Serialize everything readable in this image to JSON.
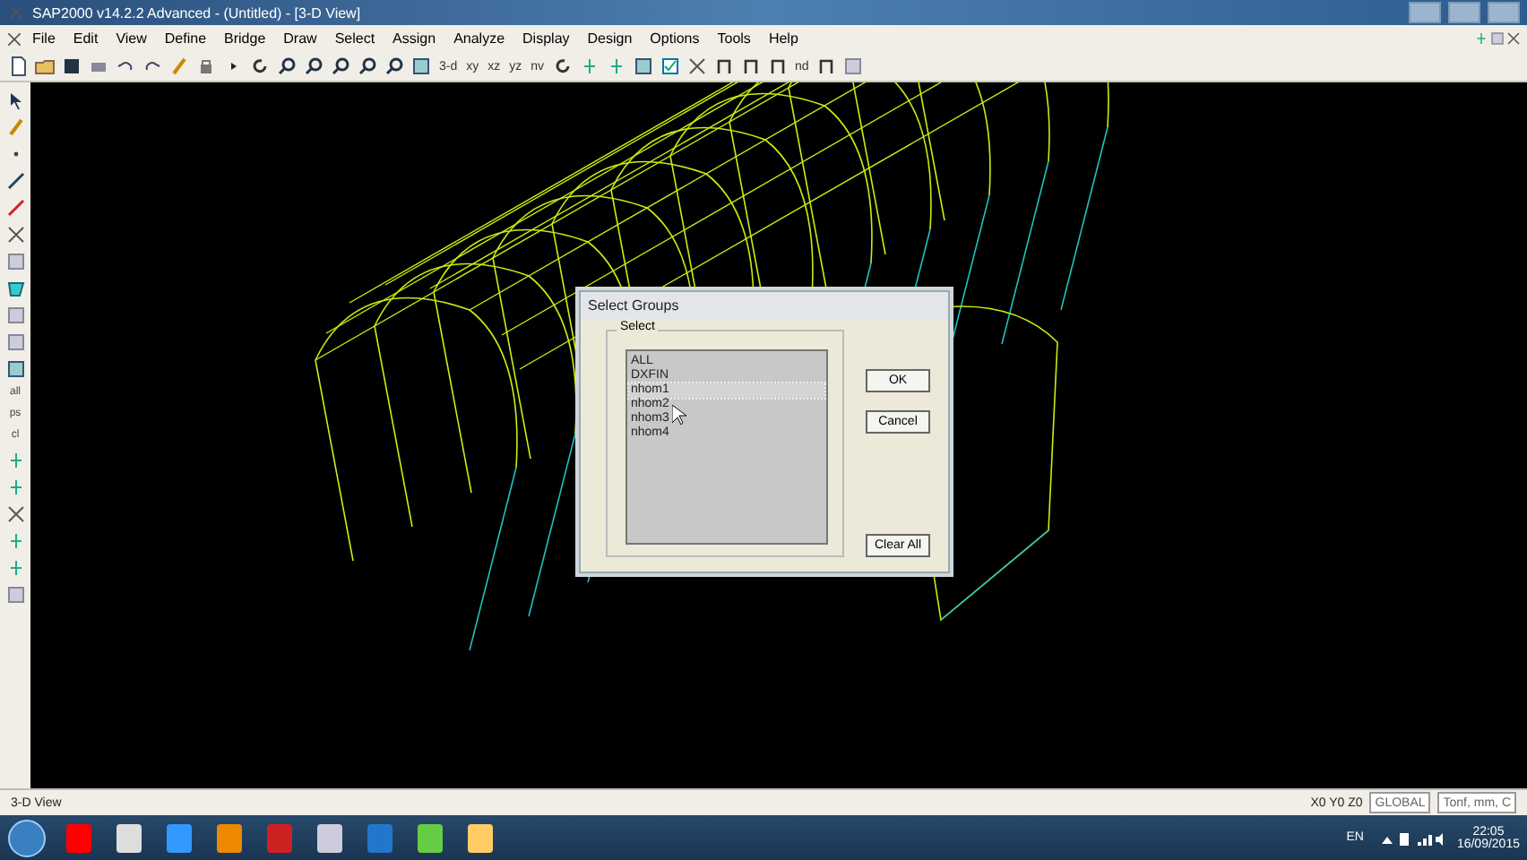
{
  "window": {
    "title": "SAP2000 v14.2.2 Advanced  - (Untitled) - [3-D View]"
  },
  "menu": [
    "File",
    "Edit",
    "View",
    "Define",
    "Bridge",
    "Draw",
    "Select",
    "Assign",
    "Analyze",
    "Display",
    "Design",
    "Options",
    "Tools",
    "Help"
  ],
  "toolbar": {
    "view_buttons": [
      "3-d",
      "xy",
      "xz",
      "yz",
      "nv"
    ],
    "nd_button": "nd"
  },
  "side_toolbar": {
    "text_buttons": [
      "all",
      "ps",
      "cl"
    ]
  },
  "dialog": {
    "title": "Select Groups",
    "group_label": "Select",
    "groups": [
      {
        "name": "ALL",
        "selected": false
      },
      {
        "name": "DXFIN",
        "selected": false
      },
      {
        "name": "nhom1",
        "selected": true
      },
      {
        "name": "nhom2",
        "selected": false
      },
      {
        "name": "nhom3",
        "selected": false
      },
      {
        "name": "nhom4",
        "selected": false
      }
    ],
    "buttons": [
      "OK",
      "Cancel"
    ],
    "clear_button": "Clear All"
  },
  "status_bar": {
    "view": "3-D View",
    "coords": "X0  Y0  Z0",
    "coord_system": "GLOBAL",
    "units": "Tonf, mm, C"
  },
  "taskbar": {
    "language": "EN",
    "time": "22:05",
    "date": "16/09/2015"
  }
}
